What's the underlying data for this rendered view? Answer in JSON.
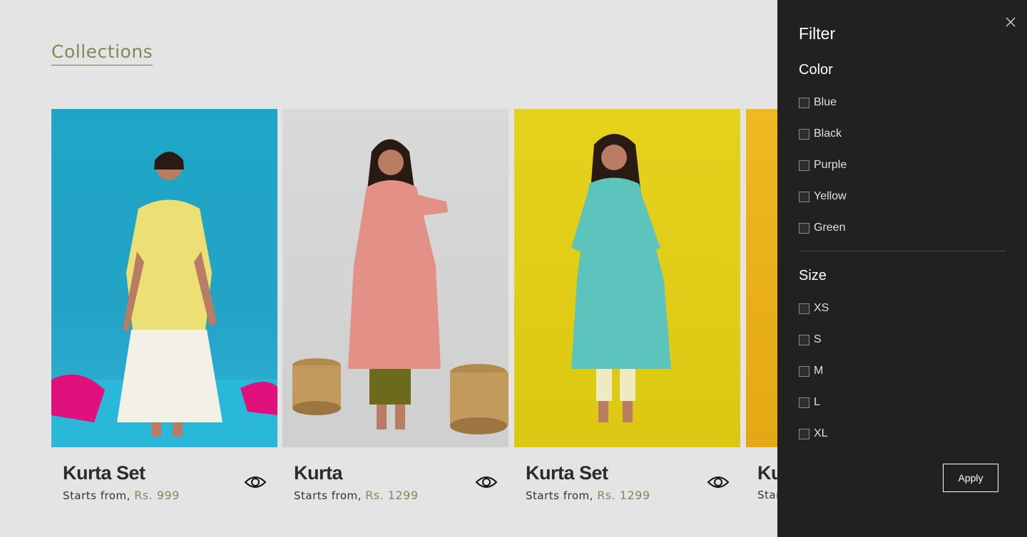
{
  "page": {
    "title": "Collections"
  },
  "products": [
    {
      "name": "Kurta Set",
      "price_prefix": "Starts from,",
      "price": "Rs. 999"
    },
    {
      "name": "Kurta",
      "price_prefix": "Starts from,",
      "price": "Rs. 1299"
    },
    {
      "name": "Kurta Set",
      "price_prefix": "Starts from,",
      "price": "Rs. 1299"
    },
    {
      "name": "Ku",
      "price_prefix": "Star",
      "price": ""
    }
  ],
  "filter": {
    "title": "Filter",
    "color_heading": "Color",
    "colors": [
      "Blue",
      "Black",
      "Purple",
      "Yellow",
      "Green"
    ],
    "size_heading": "Size",
    "sizes": [
      "XS",
      "S",
      "M",
      "L",
      "XL"
    ],
    "apply_label": "Apply",
    "close_icon": "close-icon"
  },
  "theme": {
    "accent": "#7d8b5a",
    "panel_bg": "#212121",
    "page_bg": "#e4e4e4"
  }
}
